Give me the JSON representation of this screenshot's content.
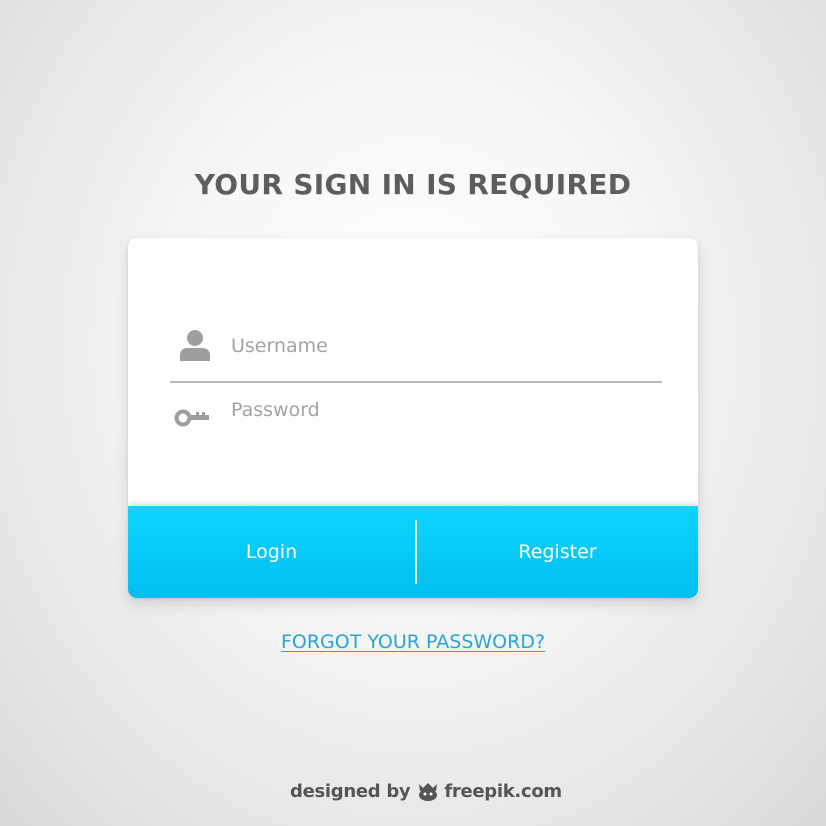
{
  "title": "YOUR SIGN IN IS REQUIRED",
  "form": {
    "username": {
      "placeholder": "Username",
      "value": "",
      "icon": "user-icon"
    },
    "password": {
      "placeholder": "Password",
      "value": "",
      "icon": "key-icon"
    }
  },
  "actions": {
    "login_label": "Login",
    "register_label": "Register"
  },
  "forgot_link": "FORGOT YOUR PASSWORD?",
  "credit": {
    "prefix": "designed by",
    "brand": "freepik.com",
    "logo_icon": "freepik-logo-icon"
  },
  "colors": {
    "accent": "#00c4f5",
    "link": "#2aa4d6",
    "title": "#5d5d5d",
    "icon": "#9e9e9e"
  }
}
